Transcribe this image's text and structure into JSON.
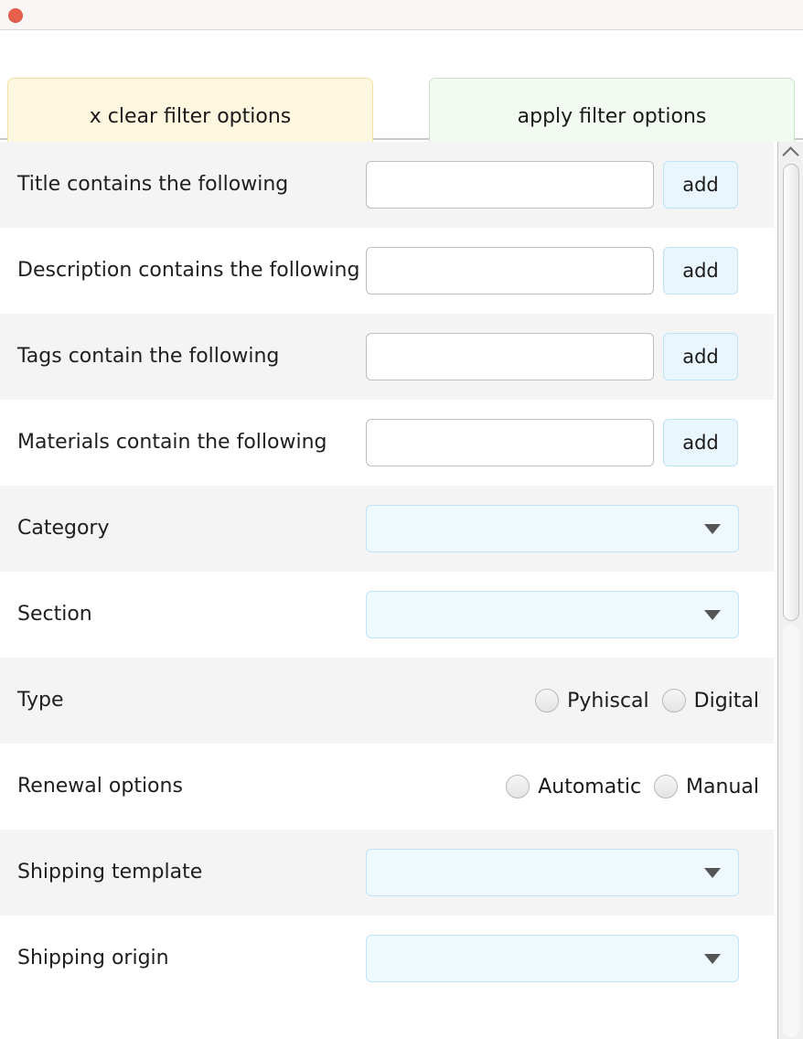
{
  "window": {
    "close_button": "close"
  },
  "actionbar": {
    "clear_label": "x clear filter options",
    "apply_label": "apply filter options"
  },
  "colors": {
    "clear_bg": "#fdf7e0",
    "clear_border": "#f3e0a0",
    "apply_bg": "#f2faf2",
    "apply_border": "#c8e3c8",
    "field_accent": "#bfe3f7",
    "select_bg": "#eef8fd",
    "stripe_bg": "#f4f4f4",
    "close_button": "#e8604c"
  },
  "scrollbar": {
    "arrow_up": "chevron-up"
  },
  "filters": {
    "rows": [
      {
        "label": "Title contains the following",
        "control": "text-add",
        "value": "",
        "placeholder": "",
        "add_label": "add",
        "name": "title"
      },
      {
        "label": "Description contains the following",
        "control": "text-add",
        "value": "",
        "placeholder": "",
        "add_label": "add",
        "name": "description"
      },
      {
        "label": "Tags contain the following",
        "control": "text-add",
        "value": "",
        "placeholder": "",
        "add_label": "add",
        "name": "tags"
      },
      {
        "label": "Materials contain the following",
        "control": "text-add",
        "value": "",
        "placeholder": "",
        "add_label": "add",
        "name": "materials"
      },
      {
        "label": "Category",
        "control": "select",
        "value": "",
        "name": "category"
      },
      {
        "label": "Section",
        "control": "select",
        "value": "",
        "name": "section"
      },
      {
        "label": "Type",
        "control": "radio",
        "options": [
          "Pyhiscal",
          "Digital"
        ],
        "selected": null,
        "name": "type"
      },
      {
        "label": "Renewal options",
        "control": "radio",
        "options": [
          "Automatic",
          "Manual"
        ],
        "selected": null,
        "name": "renewal-options"
      },
      {
        "label": "Shipping template",
        "control": "select",
        "value": "",
        "name": "shipping-template"
      },
      {
        "label": "Shipping origin",
        "control": "select",
        "value": "",
        "name": "shipping-origin"
      }
    ]
  }
}
